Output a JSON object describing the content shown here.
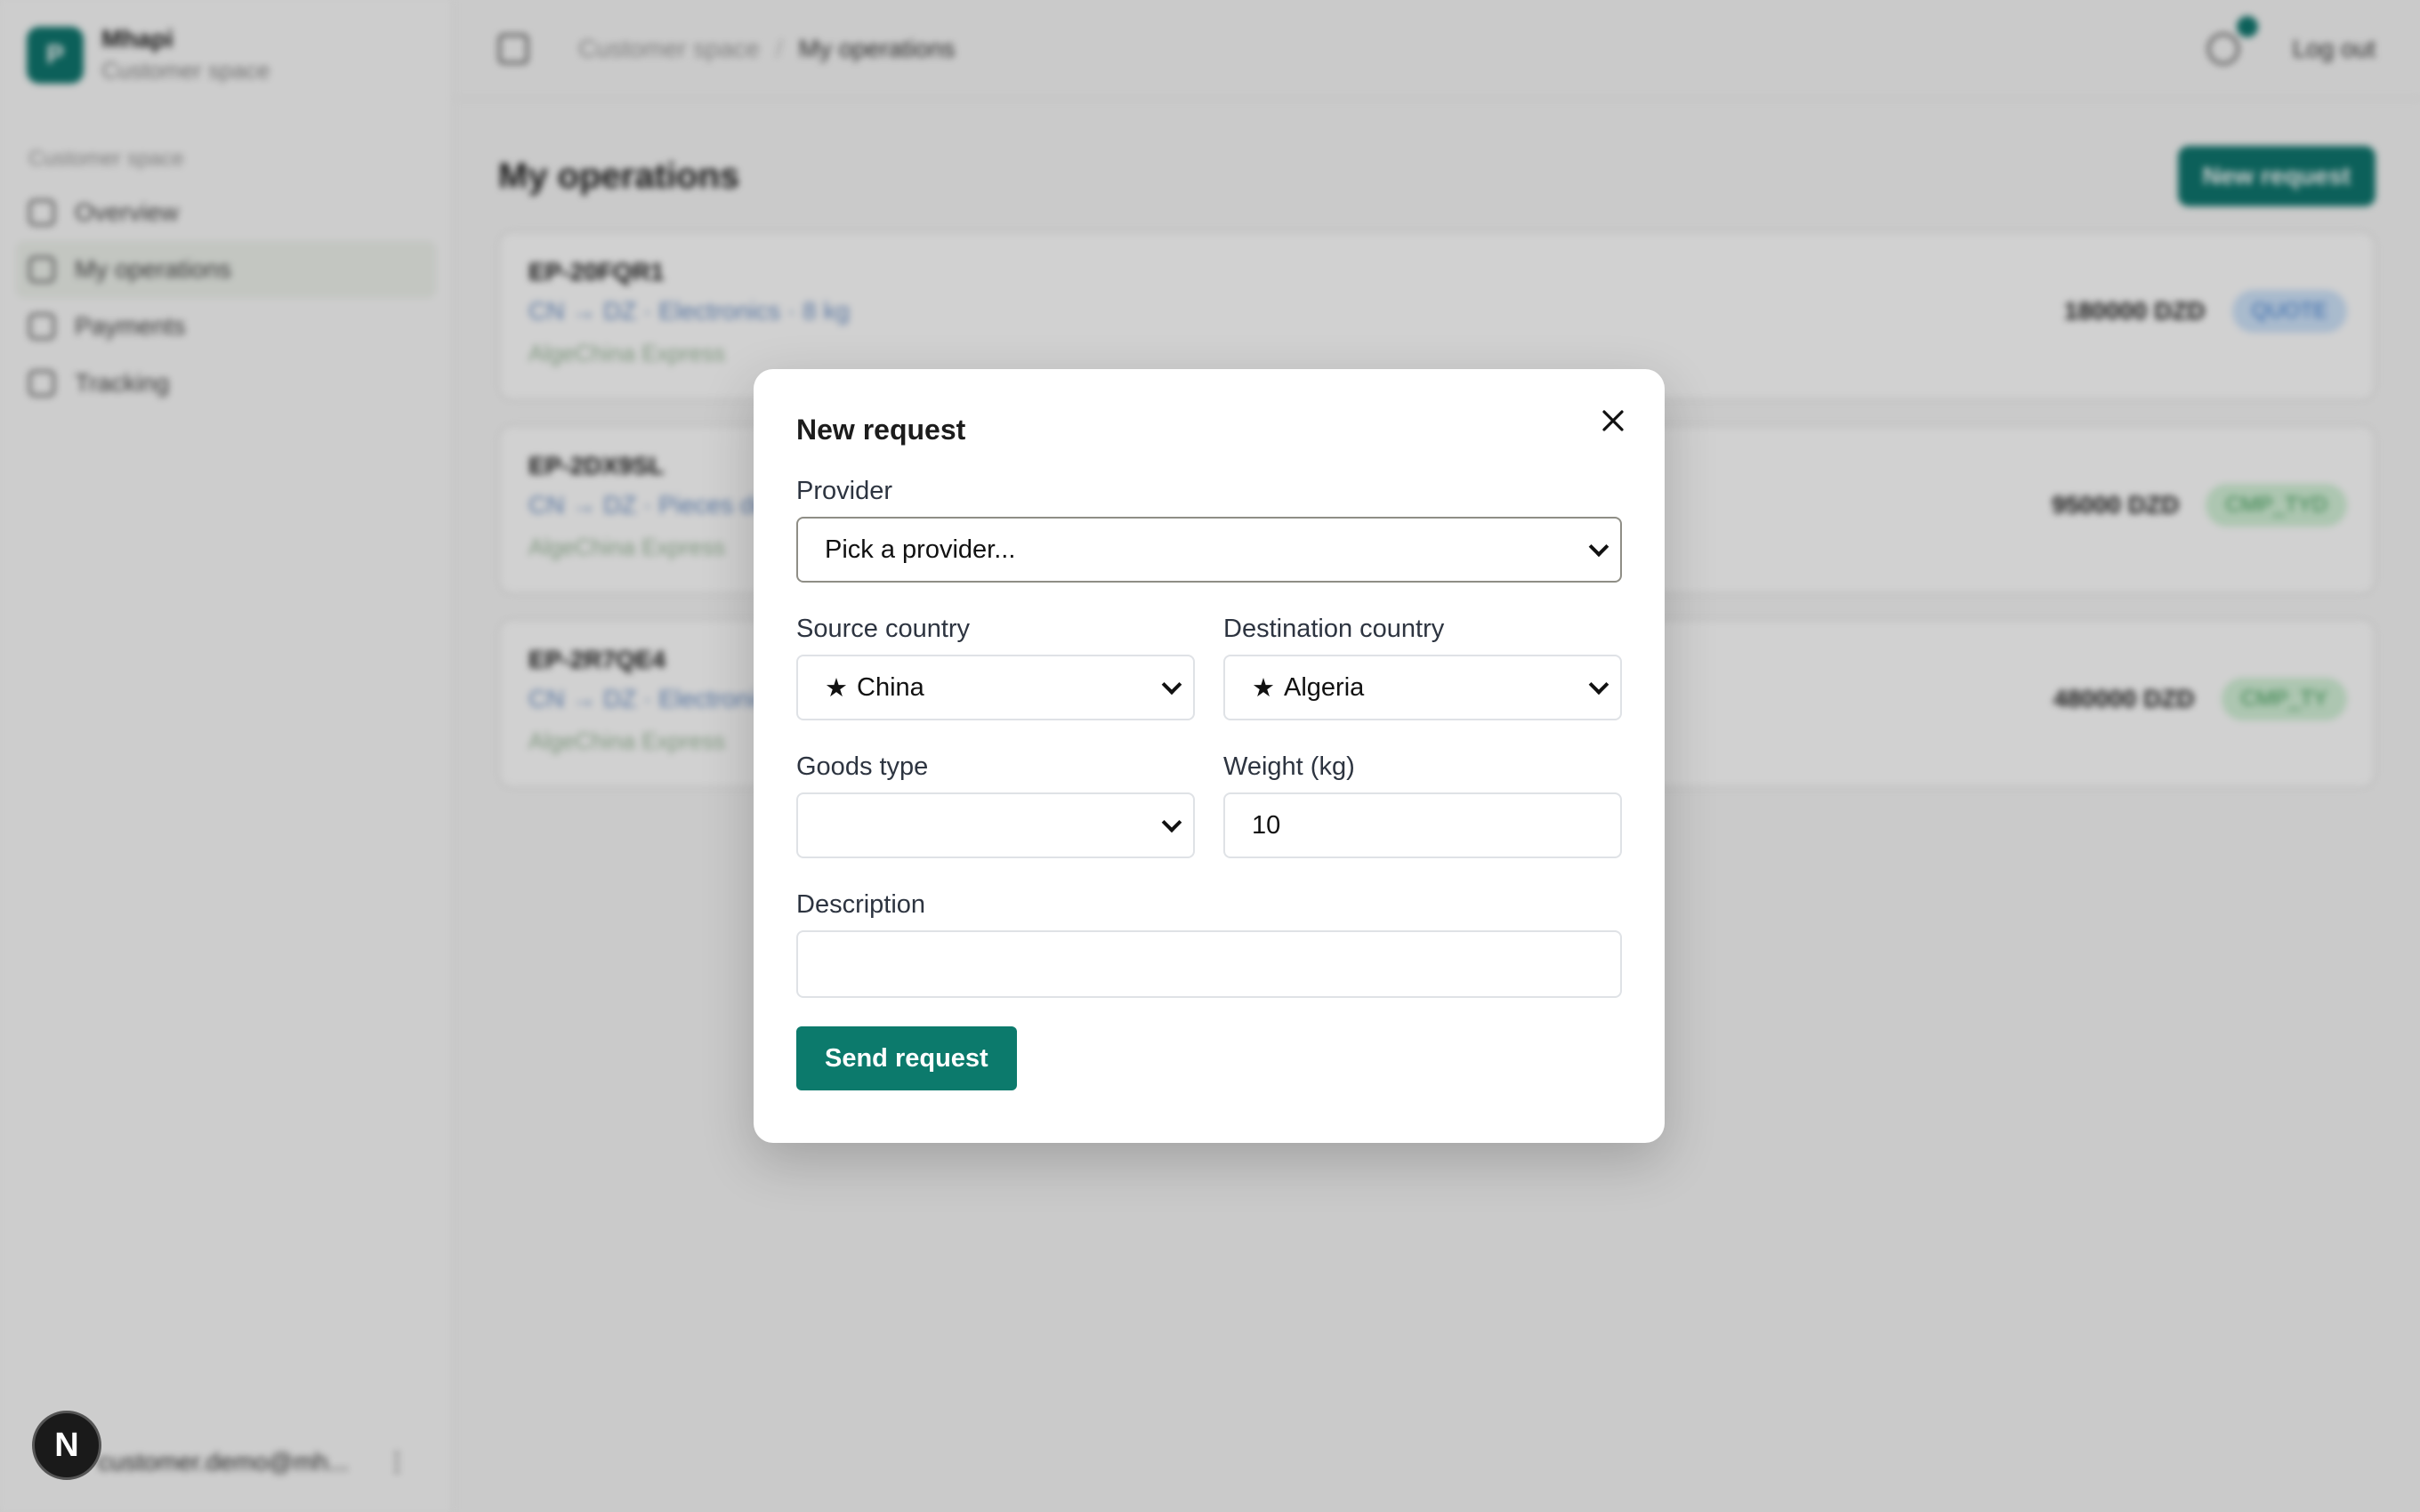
{
  "sidebar": {
    "brand_initial": "P",
    "brand_name": "Mhapi",
    "brand_sub": "Customer space",
    "group_label": "Customer space",
    "items": [
      {
        "label": "Overview"
      },
      {
        "label": "My operations"
      },
      {
        "label": "Payments"
      },
      {
        "label": "Tracking"
      }
    ],
    "user_email": "customer.demo@mh...",
    "user_menu": "⋮"
  },
  "topbar": {
    "crumb_root": "Customer space",
    "crumb_sep": "/",
    "crumb_current": "My operations",
    "logout_label": "Log out"
  },
  "content": {
    "title": "My operations",
    "new_request_label": "New request",
    "operations": [
      {
        "id": "EP-20FQR1",
        "meta": "CN → DZ · Electronics · 8 kg",
        "provider": "AlgeChina Express",
        "amount": "180000 DZD",
        "status": "QUOTE"
      },
      {
        "id": "EP-2DX9SL",
        "meta": "CN → DZ · Pieces détachées",
        "provider": "AlgeChina Express",
        "amount": "95000 DZD",
        "status": "CMP_TYD"
      },
      {
        "id": "EP-2R7QE4",
        "meta": "CN → DZ · Electronics",
        "provider": "AlgeChina Express",
        "amount": "480000 DZD",
        "status": "CMP_TY"
      }
    ]
  },
  "modal": {
    "title": "New request",
    "provider_label": "Provider",
    "provider_value": "Pick a provider...",
    "source_label": "Source country",
    "source_value": "China",
    "destination_label": "Destination country",
    "destination_value": "Algeria",
    "goods_label": "Goods type",
    "goods_value": "",
    "weight_label": "Weight (kg)",
    "weight_value": "10",
    "description_label": "Description",
    "description_value": "",
    "submit_label": "Send request"
  },
  "dev_badge": "N",
  "colors": {
    "primary": "#0c7a6c",
    "overlay": "rgba(0,0,0,0.18)"
  }
}
